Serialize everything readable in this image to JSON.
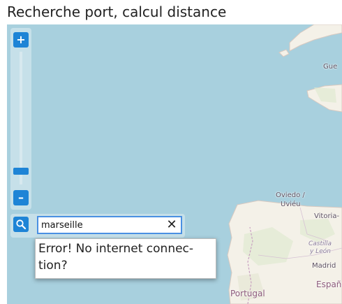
{
  "page": {
    "title": "Recherche port, calcul distance"
  },
  "zoom": {
    "plus_label": "+",
    "minus_label": "–",
    "level": 0.08
  },
  "search": {
    "value": "marseille",
    "clear_label": "✕"
  },
  "error": {
    "message": "Error! No internet connec-tion?"
  },
  "map": {
    "labels": {
      "guernsey": "Gue",
      "oviedo": "Oviedo /",
      "uvieu": "Uviéu",
      "vitoria": "Vitoria-",
      "castilla": "Castilla",
      "leon": "y León",
      "madrid": "Madrid",
      "portugal": "Portugal",
      "espana": "España"
    }
  }
}
